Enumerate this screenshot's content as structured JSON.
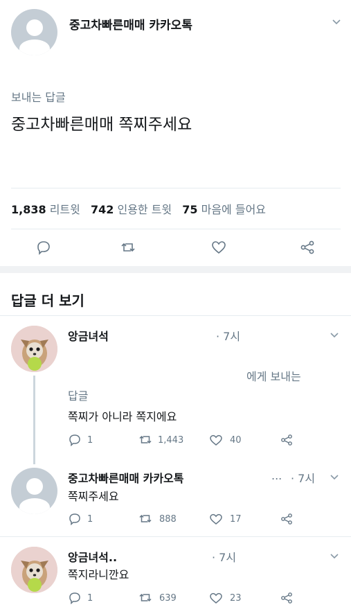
{
  "main_tweet": {
    "display_name": "중고차빠른매매 카카오톡",
    "reply_label": "보내는 답글",
    "text": "중고차빠른매매 쪽찌주세요",
    "stats": {
      "retweets_count": "1,838",
      "retweets_label": "리트윗",
      "quotes_count": "742",
      "quotes_label": "인용한 트윗",
      "likes_count": "75",
      "likes_label": "마음에 들어요"
    },
    "action_icons": [
      "reply-icon",
      "retweet-icon",
      "like-icon",
      "share-icon"
    ]
  },
  "more_replies_heading": "답글 더 보기",
  "replies": [
    {
      "name": "앙금녀석",
      "time": "· 7시",
      "reply_to_label": "에게 보내는",
      "reply_to_label2": "답글",
      "text": "쪽찌가 아니라 쪽지에요",
      "reply_count": "1",
      "retweet_count": "1,443",
      "like_count": "40"
    },
    {
      "name": "중고차빠른매매 카카오톡",
      "ellipsis": "...",
      "time": "· 7시",
      "text": "쪽찌주세요",
      "reply_count": "1",
      "retweet_count": "888",
      "like_count": "17"
    },
    {
      "name": "앙금녀석..",
      "time": "· 7시",
      "text": "쪽지라니깐요",
      "reply_count": "1",
      "retweet_count": "639",
      "like_count": "23"
    }
  ],
  "colors": {
    "text": "#14171a",
    "muted": "#657786",
    "divider": "#e6ecf0",
    "avatar_default": "#c4cdd5"
  }
}
